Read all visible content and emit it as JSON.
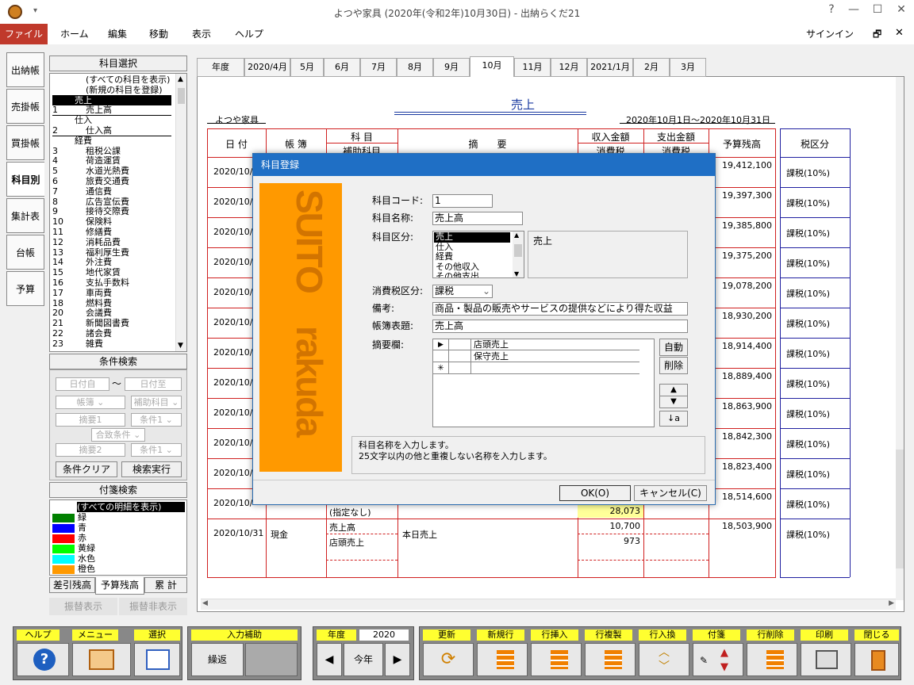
{
  "window": {
    "title": "よつや家具 (2020年(令和2年)10月30日) - 出納らくだ21",
    "help": "?",
    "minimize": "—",
    "maximize": "☐",
    "close": "✕",
    "signin": "サインイン",
    "restore": "🗗",
    "close2": "✕"
  },
  "menu": [
    "ファイル",
    "ホーム",
    "編集",
    "移動",
    "表示",
    "ヘルプ"
  ],
  "side_tabs": [
    "出納帳",
    "売掛帳",
    "買掛帳",
    "科目別",
    "集計表",
    "台帳",
    "予算"
  ],
  "account_panel": {
    "header": "科目選択",
    "items": [
      {
        "code": "",
        "name": "(すべての科目を表示)",
        "indent": 1
      },
      {
        "code": "",
        "name": "(新規の科目を登録)",
        "indent": 1
      },
      {
        "code": "",
        "name": "売上",
        "indent": 0,
        "selected": true
      },
      {
        "code": "1",
        "name": "売上高",
        "indent": 1
      },
      {
        "code": "",
        "name": "仕入",
        "indent": 0
      },
      {
        "code": "2",
        "name": "仕入高",
        "indent": 1
      },
      {
        "code": "",
        "name": "経費",
        "indent": 0
      },
      {
        "code": "3",
        "name": "租税公課",
        "indent": 1
      },
      {
        "code": "4",
        "name": "荷造運賃",
        "indent": 1
      },
      {
        "code": "5",
        "name": "水道光熱費",
        "indent": 1
      },
      {
        "code": "6",
        "name": "旅費交通費",
        "indent": 1
      },
      {
        "code": "7",
        "name": "通信費",
        "indent": 1
      },
      {
        "code": "8",
        "name": "広告宣伝費",
        "indent": 1
      },
      {
        "code": "9",
        "name": "接待交際費",
        "indent": 1
      },
      {
        "code": "10",
        "name": "保険料",
        "indent": 1
      },
      {
        "code": "11",
        "name": "修繕費",
        "indent": 1
      },
      {
        "code": "12",
        "name": "消耗品費",
        "indent": 1
      },
      {
        "code": "13",
        "name": "福利厚生費",
        "indent": 1
      },
      {
        "code": "14",
        "name": "外注費",
        "indent": 1
      },
      {
        "code": "15",
        "name": "地代家賃",
        "indent": 1
      },
      {
        "code": "16",
        "name": "支払手数料",
        "indent": 1
      },
      {
        "code": "17",
        "name": "車両費",
        "indent": 1
      },
      {
        "code": "18",
        "name": "燃料費",
        "indent": 1
      },
      {
        "code": "20",
        "name": "会議費",
        "indent": 1
      },
      {
        "code": "21",
        "name": "新聞図書費",
        "indent": 1
      },
      {
        "code": "22",
        "name": "諸会費",
        "indent": 1
      },
      {
        "code": "23",
        "name": "雑費",
        "indent": 1
      }
    ]
  },
  "search_panel": {
    "header": "条件検索",
    "date_from": "日付自",
    "tilde": "〜",
    "date_to": "日付至",
    "book": "帳簿",
    "sub_account": "補助科目",
    "summary1": "摘要1",
    "cond1": "条件1",
    "match": "合致条件",
    "summary2": "摘要2",
    "cond1b": "条件1",
    "clear_btn": "条件クリア",
    "search_btn": "検索実行"
  },
  "tag_panel": {
    "header": "付箋検索",
    "all": "(すべての明細を表示)",
    "tags": [
      {
        "name": "緑",
        "color": "#008000"
      },
      {
        "name": "青",
        "color": "#0000ff"
      },
      {
        "name": "赤",
        "color": "#ff0000"
      },
      {
        "name": "黄緑",
        "color": "#00ff00"
      },
      {
        "name": "水色",
        "color": "#00ffff"
      },
      {
        "name": "橙色",
        "color": "#ff9900"
      }
    ]
  },
  "bottom_tabs": [
    "差引残高",
    "予算残高",
    "累 計"
  ],
  "bottom_btns": [
    "振替表示",
    "振替非表示"
  ],
  "month_tabs": [
    "年度",
    "2020/4月",
    "5月",
    "6月",
    "7月",
    "8月",
    "9月",
    "10月",
    "11月",
    "12月",
    "2021/1月",
    "2月",
    "3月"
  ],
  "ledger": {
    "title": "売上",
    "company": "よつや家具",
    "period": "2020年10月1日〜2020年10月31日",
    "headers": {
      "date": "日 付",
      "book": "帳 簿",
      "account": "科 目",
      "sub_account": "補助科目",
      "summary": "摘　　要",
      "income": "収入金額",
      "tax1": "消費税",
      "expense": "支出金額",
      "tax2": "消費税",
      "budget": "予算残高",
      "tax_class": "税区分"
    },
    "rows": [
      {
        "date": "2020/10/",
        "balance": "19,412,100",
        "tax": "課税(10%)"
      },
      {
        "date": "2020/10/",
        "balance": "19,397,300",
        "tax": "課税(10%)"
      },
      {
        "date": "2020/10/",
        "balance": "19,385,800",
        "tax": "課税(10%)"
      },
      {
        "date": "2020/10/",
        "balance": "19,375,200",
        "tax": "課税(10%)"
      },
      {
        "date": "2020/10/",
        "balance": "19,078,200",
        "tax": "課税(10%)"
      },
      {
        "date": "2020/10/",
        "balance": "18,930,200",
        "tax": "課税(10%)"
      },
      {
        "date": "2020/10/",
        "balance": "18,914,400",
        "tax": "課税(10%)"
      },
      {
        "date": "2020/10/",
        "balance": "18,889,400",
        "tax": "課税(10%)"
      },
      {
        "date": "2020/10/",
        "balance": "18,863,900",
        "tax": "課税(10%)"
      },
      {
        "date": "2020/10/",
        "balance": "18,842,300",
        "tax": "課税(10%)"
      },
      {
        "date": "2020/10/",
        "balance": "18,823,400",
        "tax": "課税(10%)"
      },
      {
        "date": "2020/10/",
        "balance": "18,514,600",
        "tax": "課税(10%)"
      }
    ],
    "row12_sub": "(指定なし)",
    "row12_tax": "28,073",
    "last_row": {
      "date": "2020/10/31",
      "book": "現金",
      "account": "売上高",
      "sub": "店頭売上",
      "summary": "本日売上",
      "income": "10,700",
      "tax": "973",
      "balance": "18,503,900",
      "tax_class": "課税(10%)"
    }
  },
  "dialog": {
    "title": "科目登録",
    "brand_top": "SUITO",
    "brand_bottom": "rakuda",
    "code_label": "科目コード:",
    "code_value": "1",
    "name_label": "科目名称:",
    "name_value": "売上高",
    "class_label": "科目区分:",
    "class_options": [
      "売上",
      "仕入",
      "経費",
      "その他収入",
      "その他支出"
    ],
    "class_display": "売上",
    "tax_label": "消費税区分:",
    "tax_value": "課税",
    "note_label": "備考:",
    "note_value": "商品・製品の販売やサービスの提供などにより得た収益",
    "book_title_label": "帳簿表題:",
    "book_title_value": "売上高",
    "summary_label": "摘要欄:",
    "summary_rows": [
      "店頭売上",
      "保守売上"
    ],
    "row_marker": "▶",
    "new_marker": "✳",
    "auto_btn": "自動",
    "delete_btn": "削除",
    "hint1": "科目名称を入力します。",
    "hint2": "25文字以内の他と重複しない名称を入力します。",
    "ok": "OK(O)",
    "cancel": "キャンセル(C)"
  },
  "toolbar": {
    "help": "ヘルプ",
    "menu": "メニュー",
    "select": "選択",
    "input_assist": "入力補助",
    "repeat": "繰返",
    "year_label": "年度",
    "year_value": "2020",
    "this_year": "今年",
    "refresh": "更新",
    "new_row": "新規行",
    "insert_row": "行挿入",
    "copy_row": "行複製",
    "swap_row": "行入換",
    "tag": "付箋",
    "delete_row": "行削除",
    "print": "印刷",
    "close": "閉じる"
  }
}
